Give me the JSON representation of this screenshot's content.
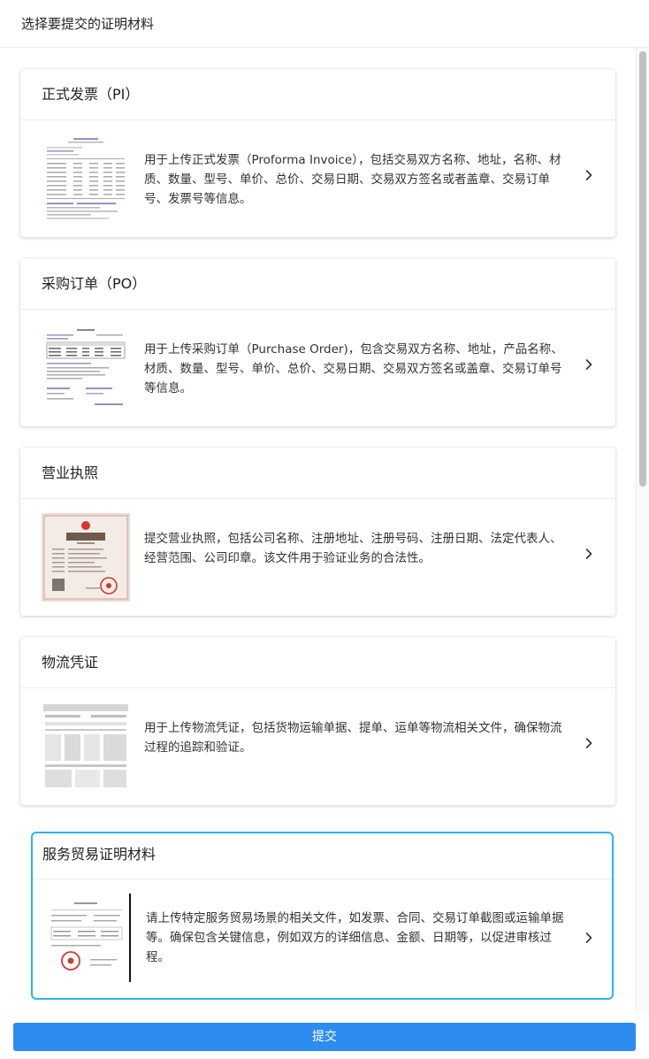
{
  "header": {
    "title": "选择要提交的证明材料"
  },
  "cards": [
    {
      "title": "正式发票（PI）",
      "description": "用于上传正式发票（Proforma Invoice），包括交易双方名称、地址，名称、材质、数量、型号、单价、总价、交易日期、交易双方签名或者盖章、交易订单号、发票号等信息。",
      "thumbnail_icon": "invoice-document-thumbnail",
      "chevron_icon": "chevron-right-icon"
    },
    {
      "title": "采购订单（PO）",
      "description": "用于上传采购订单（Purchase Order)，包含交易双方名称、地址，产品名称、材质、数量、型号、单价、总价、交易日期、交易双方签名或盖章、交易订单号等信息。",
      "thumbnail_icon": "purchase-order-document-thumbnail",
      "chevron_icon": "chevron-right-icon"
    },
    {
      "title": "营业执照",
      "description": "提交营业执照，包括公司名称、注册地址、注册号码、注册日期、法定代表人、经营范围、公司印章。该文件用于验证业务的合法性。",
      "thumbnail_icon": "business-license-thumbnail",
      "chevron_icon": "chevron-right-icon"
    },
    {
      "title": "物流凭证",
      "description": "用于上传物流凭证，包括货物运输单据、提单、运单等物流相关文件，确保物流过程的追踪和验证。",
      "thumbnail_icon": "logistics-document-thumbnail",
      "chevron_icon": "chevron-right-icon"
    },
    {
      "title": "服务贸易证明材料",
      "description": "请上传特定服务贸易场景的相关文件，如发票、合同、交易订单截图或运输单据等。确保包含关键信息，例如双方的详细信息、金额、日期等，以促进审核过程。",
      "thumbnail_icon": "service-trade-document-thumbnail",
      "chevron_icon": "chevron-right-icon",
      "selected": true
    }
  ],
  "footer": {
    "submit_label": "提交"
  },
  "colors": {
    "selected_border": "#2ab5f0",
    "submit_button": "#2d8cf0",
    "divider": "#ececec"
  }
}
